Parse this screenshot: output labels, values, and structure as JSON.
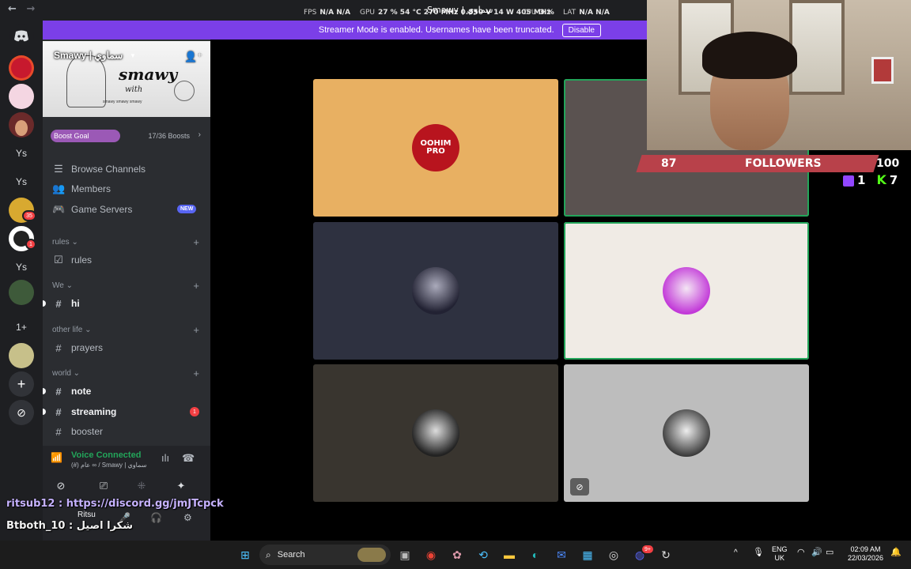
{
  "perf": {
    "fps_label": "FPS",
    "fps_value": "N/A N/A",
    "gpu_label": "GPU",
    "gpu_value": "27 % 54 °C 270 MHz 0.850 V 14 W 405 MHz",
    "cpu_label": "CPU",
    "cpu_value": "3 %",
    "lat_label": "LAT",
    "lat_value": "N/A N/A",
    "window_title": "Smawy | سماوي"
  },
  "banner": {
    "text": "Streamer Mode is enabled. Usernames have been truncated.",
    "button": "Disable"
  },
  "rail": {
    "servers": [
      "Ys",
      "Ys",
      "Ys",
      "1+"
    ],
    "badge_35": "35",
    "badge_1": "1"
  },
  "server": {
    "name": "Smawy | سماوي",
    "banner_logo": "smawy",
    "banner_sub": "with",
    "banner_handles": "smawy  smawy  smawy",
    "boost_label": "Boost Goal",
    "boost_count": "17/36 Boosts",
    "boost_progress": 0.47
  },
  "nav": {
    "browse": "Browse Channels",
    "members": "Members",
    "game_servers": "Game Servers",
    "new_badge": "NEW"
  },
  "categories": {
    "rules": "rules",
    "we": "We",
    "other_life": "other life",
    "world": "world"
  },
  "channels": {
    "rules": "rules",
    "hi": "hi",
    "prayers": "prayers",
    "note": "note",
    "streaming": "streaming",
    "streaming_mentions": "1",
    "booster": "booster"
  },
  "voice": {
    "status": "Voice Connected",
    "location": "(#) عام ∞ / Smawy | سماوي",
    "user": "Ritsu"
  },
  "chat": {
    "line1_name": "ritsub12 :",
    "line1_link": "https://discord.gg/jmJTcpck",
    "line2_name": "Btboth_10 :",
    "line2_text": "شكرا اصيل"
  },
  "tiles": {
    "tile1_text": "OOHIM PRO"
  },
  "followers": {
    "current": "87",
    "label": "FOLLOWERS",
    "goal": "100",
    "twitch_count": "1",
    "kick_count": "7"
  },
  "taskbar": {
    "search": "Search",
    "lang_line1": "ENG",
    "lang_line2": "UK",
    "time": "02:09 AM",
    "date": "22/03/2026",
    "discord_badge": "9+"
  },
  "colors": {
    "accent": "#5865f2",
    "banner": "#7b3fe8",
    "speaking": "#23a55a",
    "mention": "#f23f43"
  }
}
